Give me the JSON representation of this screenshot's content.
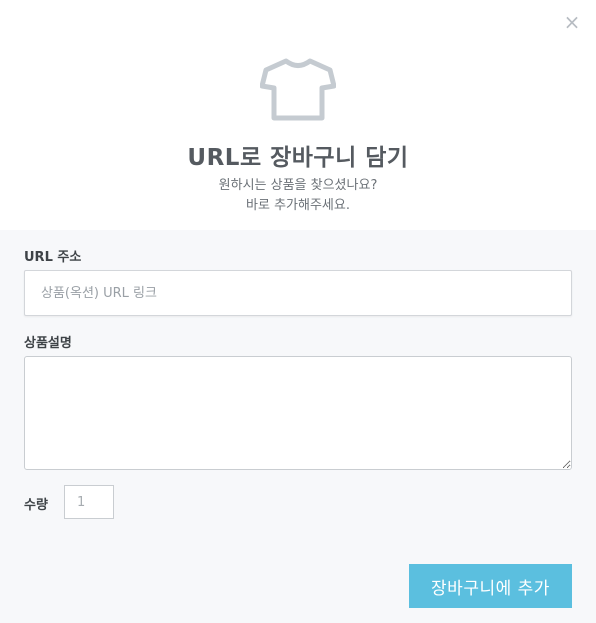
{
  "modal": {
    "close_label": "×",
    "icon": "tshirt-icon",
    "title": "URL로 장바구니 담기",
    "subtitle_line1": "원하시는 상품을 찾으셨나요?",
    "subtitle_line2": "바로 추가해주세요."
  },
  "form": {
    "url_label": "URL 주소",
    "url_placeholder": "상품(옥션) URL 링크",
    "url_value": "",
    "desc_label": "상품설명",
    "desc_value": "",
    "qty_label": "수량",
    "qty_placeholder": "1",
    "submit_label": "장바구니에 추가"
  },
  "colors": {
    "accent": "#5bbfdf",
    "icon": "#c5cbd1",
    "body_bg": "#f7f8fa"
  }
}
